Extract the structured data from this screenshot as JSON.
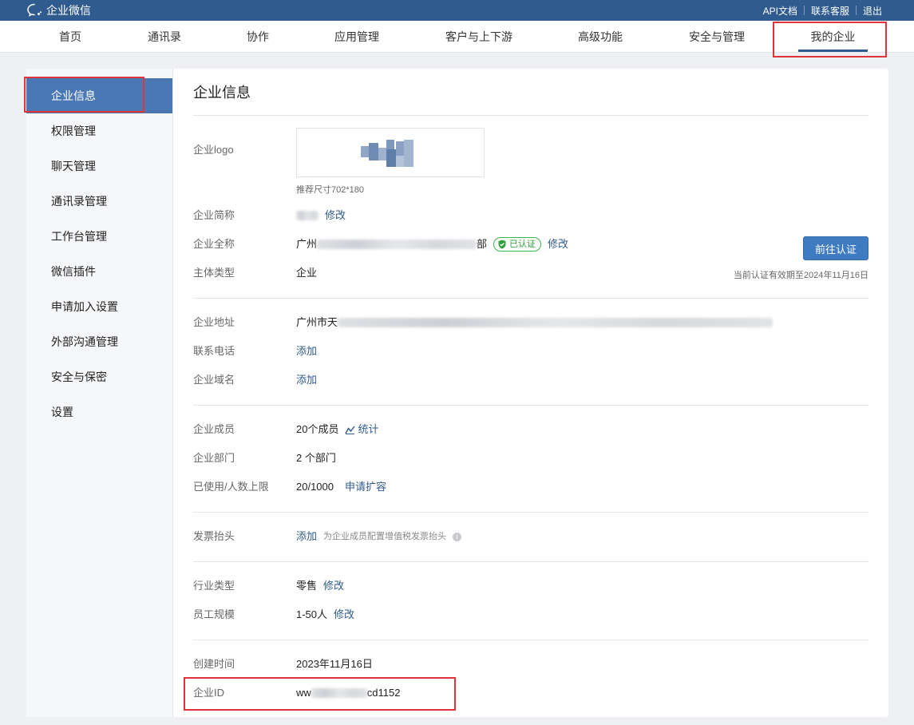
{
  "header": {
    "brand": "企业微信",
    "links": [
      "API文档",
      "联系客服",
      "退出"
    ]
  },
  "nav": {
    "items": [
      "首页",
      "通讯录",
      "协作",
      "应用管理",
      "客户与上下游",
      "高级功能",
      "安全与管理",
      "我的企业"
    ],
    "active_index": 7
  },
  "sidebar": {
    "items": [
      "企业信息",
      "权限管理",
      "聊天管理",
      "通讯录管理",
      "工作台管理",
      "微信插件",
      "申请加入设置",
      "外部沟通管理",
      "安全与保密",
      "设置"
    ],
    "active_index": 0
  },
  "main": {
    "title": "企业信息",
    "logo": {
      "label": "企业logo",
      "hint": "推荐尺寸702*180"
    },
    "short_name": {
      "label": "企业简称",
      "action": "修改"
    },
    "full_name": {
      "label": "企业全称",
      "prefix": "广州",
      "suffix": "部",
      "badge": "已认证",
      "action": "修改"
    },
    "verify_button": "前往认证",
    "subject_type": {
      "label": "主体类型",
      "value": "企业"
    },
    "expire_note": "当前认证有效期至2024年11月16日",
    "address": {
      "label": "企业地址",
      "prefix": "广州市天"
    },
    "phone": {
      "label": "联系电话",
      "action": "添加"
    },
    "domain": {
      "label": "企业域名",
      "action": "添加"
    },
    "members": {
      "label": "企业成员",
      "value": "20个成员",
      "action": "统计"
    },
    "departments": {
      "label": "企业部门",
      "value": "2 个部门"
    },
    "quota": {
      "label": "已使用/人数上限",
      "value": "20/1000",
      "action": "申请扩容"
    },
    "invoice": {
      "label": "发票抬头",
      "action": "添加",
      "hint": "为企业成员配置增值税发票抬头"
    },
    "industry": {
      "label": "行业类型",
      "value": "零售",
      "action": "修改"
    },
    "scale": {
      "label": "员工规模",
      "value": "1-50人",
      "action": "修改"
    },
    "created": {
      "label": "创建时间",
      "value": "2023年11月16日"
    },
    "corp_id": {
      "label": "企业ID",
      "prefix": "ww",
      "suffix": "cd1152"
    }
  },
  "colors": {
    "topbar": "#2f5b8f",
    "accent": "#4a78b4",
    "link": "#2f5b8f",
    "verified": "#3bb24a",
    "highlight": "#e0343a"
  }
}
